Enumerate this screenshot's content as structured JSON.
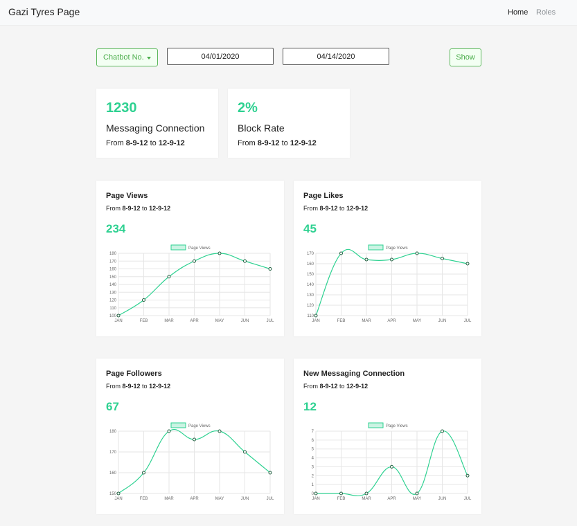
{
  "navbar": {
    "brand": "Gazi Tyres Page",
    "links": [
      {
        "label": "Home",
        "active": true
      },
      {
        "label": "Roles",
        "active": false
      }
    ]
  },
  "filters": {
    "chatbot_label": "Chatbot No.",
    "start_date": "04/01/2020",
    "end_date": "04/14/2020",
    "show_label": "Show"
  },
  "accent_color": "#2ed191",
  "stats": [
    {
      "value": "1230",
      "label": "Messaging Connection",
      "from_word": "From",
      "from": "8-9-12",
      "to_word": "to",
      "to": "12-9-12"
    },
    {
      "value": "2%",
      "label": "Block Rate",
      "from_word": "From",
      "from": "8-9-12",
      "to_word": "to",
      "to": "12-9-12"
    }
  ],
  "charts": [
    {
      "title": "Page Views",
      "value": "234",
      "from_word": "From",
      "from": "8-9-12",
      "to_word": "to",
      "to": "12-9-12"
    },
    {
      "title": "Page Likes",
      "value": "45",
      "from_word": "From",
      "from": "8-9-12",
      "to_word": "to",
      "to": "12-9-12"
    },
    {
      "title": "Page Followers",
      "value": "67",
      "from_word": "From",
      "from": "8-9-12",
      "to_word": "to",
      "to": "12-9-12"
    },
    {
      "title": "New Messaging Connection",
      "value": "12",
      "from_word": "From",
      "from": "8-9-12",
      "to_word": "to",
      "to": "12-9-12"
    }
  ],
  "chart_data": [
    {
      "type": "line",
      "legend": "Page Views",
      "legend_position": "top",
      "grid": true,
      "categories": [
        "JAN",
        "FEB",
        "MAR",
        "APR",
        "MAY",
        "JUN",
        "JUL"
      ],
      "series": [
        {
          "name": "Page Views",
          "values": [
            100,
            120,
            150,
            170,
            180,
            170,
            160
          ]
        }
      ],
      "yticks": [
        "100",
        "110",
        "120",
        "130",
        "140",
        "150",
        "160",
        "170",
        "180"
      ],
      "ylim": [
        100,
        180
      ]
    },
    {
      "type": "line",
      "legend": "Page Views",
      "legend_position": "top",
      "grid": true,
      "categories": [
        "JAN",
        "FEB",
        "MAR",
        "APR",
        "MAY",
        "JUN",
        "JUL"
      ],
      "series": [
        {
          "name": "Page Views",
          "values": [
            110,
            170,
            164,
            164,
            170,
            165,
            160
          ]
        }
      ],
      "yticks": [
        "110",
        "120",
        "130",
        "140",
        "150",
        "160",
        "170"
      ],
      "ylim": [
        110,
        170
      ]
    },
    {
      "type": "line",
      "legend": "Page Views",
      "legend_position": "top",
      "grid": true,
      "categories": [
        "JAN",
        "FEB",
        "MAR",
        "APR",
        "MAY",
        "JUN",
        "JUL"
      ],
      "series": [
        {
          "name": "Page Views",
          "values": [
            150,
            160,
            180,
            176,
            180,
            170,
            160
          ]
        }
      ],
      "yticks": [
        "150",
        "160",
        "170",
        "180"
      ],
      "ylim": [
        150,
        180
      ]
    },
    {
      "type": "line",
      "legend": "Page Views",
      "legend_position": "top",
      "grid": true,
      "categories": [
        "JAN",
        "FEB",
        "MAR",
        "APR",
        "MAY",
        "JUN",
        "JUL"
      ],
      "series": [
        {
          "name": "Page Views",
          "values": [
            0,
            0,
            0,
            3,
            0,
            7,
            2
          ]
        }
      ],
      "yticks": [
        "0",
        "1",
        "2",
        "3",
        "4",
        "5",
        "6",
        "7"
      ],
      "ylim": [
        0,
        7
      ]
    }
  ]
}
